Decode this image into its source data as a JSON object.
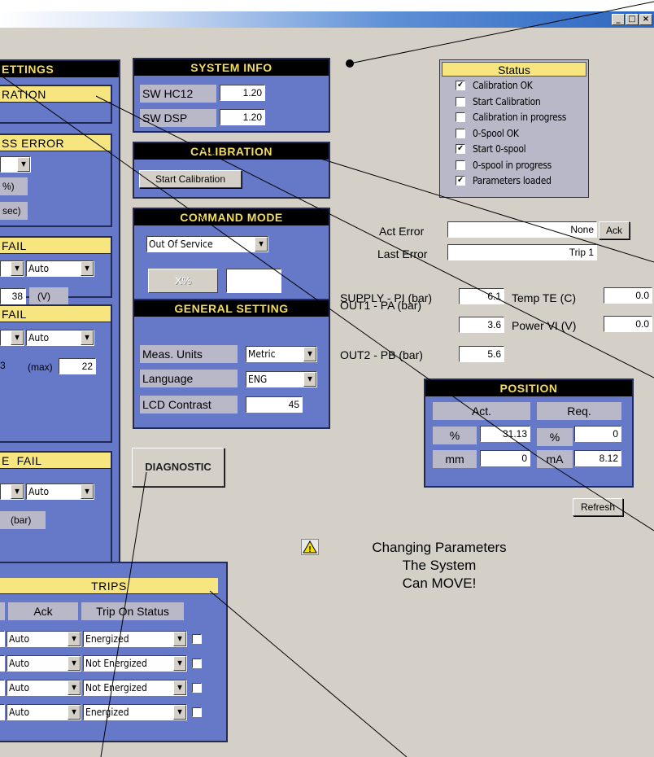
{
  "window": {
    "minimize": "_",
    "maximize": "□",
    "close": "×"
  },
  "settings": {
    "title": "ETTINGS",
    "calibration_tab": "RATION",
    "bypass_error": "SS ERROR",
    "percent_unit": "%)",
    "sec_unit": "sec)"
  },
  "fail1": {
    "title": "FAIL",
    "mode": "Auto",
    "value": "38",
    "unit": "(V)"
  },
  "fail2": {
    "title": "FAIL",
    "mode": "Auto",
    "value_left": "3",
    "max_label": "(max)",
    "max_value": "22"
  },
  "fail3": {
    "title": "E  FAIL",
    "mode": "Auto",
    "unit": "(bar)"
  },
  "system_info": {
    "title": "SYSTEM  INFO",
    "rows": [
      {
        "label": "SW HC12",
        "value": "1.20"
      },
      {
        "label": "SW DSP",
        "value": "1.20"
      }
    ]
  },
  "calibration": {
    "title": "CALIBRATION",
    "start_button": "Start Calibration"
  },
  "command_mode": {
    "title": "COMMAND MODE",
    "mode": "Out Of Service",
    "percent_button": "X%",
    "value": ""
  },
  "general_setting": {
    "title": "GENERAL SETTING",
    "rows": [
      {
        "label": "Meas. Units",
        "value": "Metric"
      },
      {
        "label": "Language",
        "value": "ENG"
      },
      {
        "label": "LCD Contrast",
        "value": "45"
      }
    ]
  },
  "diagnostic_button": "DIAGNOSTIC",
  "status": {
    "title": "Status",
    "items": [
      {
        "label": "Calibration OK",
        "checked": "✔"
      },
      {
        "label": "Start Calibration",
        "checked": ""
      },
      {
        "label": "Calibration in progress",
        "checked": ""
      },
      {
        "label": "0-Spool OK",
        "checked": ""
      },
      {
        "label": "Start 0-spool",
        "checked": "✔"
      },
      {
        "label": "0-spool in progress",
        "checked": ""
      },
      {
        "label": "Parameters loaded",
        "checked": "✔"
      }
    ]
  },
  "errors": {
    "act_label": "Act Error",
    "act_value": "None",
    "ack_button": "Ack",
    "last_label": "Last Error",
    "last_value": "Trip 1"
  },
  "measurements": {
    "supply_label": "SUPPLY - PI (bar)",
    "supply_value": "6.1",
    "temp_label": "Temp TE (C)",
    "temp_value": "0.0",
    "out1_label": "OUT1 - PA (bar)",
    "out1_value": "3.6",
    "power_label": "Power VI (V)",
    "power_value": "0.0",
    "out2_label": "OUT2 - PB (bar)",
    "out2_value": "5.6"
  },
  "position": {
    "title": "POSITION",
    "act_header": "Act.",
    "req_header": "Req.",
    "row1": {
      "unit_left": "%",
      "act": "31.13",
      "unit_right": "%",
      "req": "0"
    },
    "row2": {
      "unit_left": "mm",
      "act": "0",
      "unit_right": "mA",
      "req": "8.12"
    }
  },
  "refresh_button": "Refresh",
  "warning": {
    "icon": "warning-icon",
    "line1": "Changing Parameters",
    "line2": "The System",
    "line3": "Can MOVE!"
  },
  "trips": {
    "title": "TRIPS",
    "col_ack": "Ack",
    "col_status": "Trip On Status",
    "rows": [
      {
        "ack": "Auto",
        "status": "Energized"
      },
      {
        "ack": "Auto",
        "status": "Not Energized"
      },
      {
        "ack": "Auto",
        "status": "Not Energized"
      },
      {
        "ack": "Auto",
        "status": "Energized"
      }
    ]
  }
}
